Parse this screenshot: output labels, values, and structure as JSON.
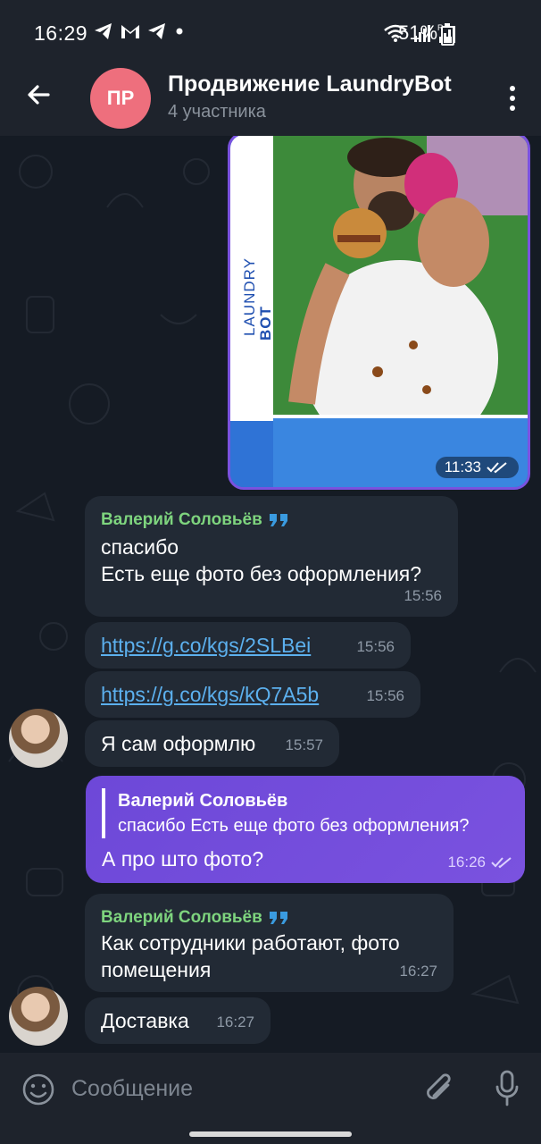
{
  "status_bar": {
    "time": "16:29",
    "battery": "51%",
    "battery_level": 0.51,
    "left_icons": [
      "telegram-icon",
      "gmail-icon",
      "telegram-icon",
      "dot-icon"
    ],
    "right_icons": [
      "wifi-icon",
      "signal-icon",
      "signal-r-icon",
      "battery-icon"
    ]
  },
  "header": {
    "avatar_initials": "ПР",
    "avatar_color": "#ee6f7d",
    "title": "Продвижение LaundryBot",
    "subtitle": "4 участника"
  },
  "messages": {
    "photo": {
      "brand_line1": "LAUNDRY",
      "brand_line2": "BOT",
      "time": "11:33"
    },
    "m1": {
      "sender": "Валерий Соловьёв",
      "line1": "спасибо",
      "line2": "Есть еще фото без оформления?",
      "time": "15:56"
    },
    "m2": {
      "link": "https://g.co/kgs/2SLBei",
      "time": "15:56"
    },
    "m3": {
      "link": "https://g.co/kgs/kQ7A5b",
      "time": "15:56"
    },
    "m4": {
      "text": "Я сам оформлю",
      "time": "15:57"
    },
    "m5": {
      "reply_sender": "Валерий Соловьёв",
      "reply_text": "спасибо Есть еще фото без оформления?",
      "text": "А про што фото?",
      "time": "16:26"
    },
    "m6": {
      "sender": "Валерий Соловьёв",
      "line1": "Как сотрудники работают, фото",
      "line2": "помещения",
      "time": "16:27"
    },
    "m7": {
      "text": "Доставка",
      "time": "16:27"
    }
  },
  "input": {
    "placeholder": "Сообщение"
  },
  "colors": {
    "accent_outgoing": "#7a52df",
    "sender_name": "#7ed47e",
    "link": "#5cb0ee",
    "incoming_bubble": "#222a35"
  }
}
